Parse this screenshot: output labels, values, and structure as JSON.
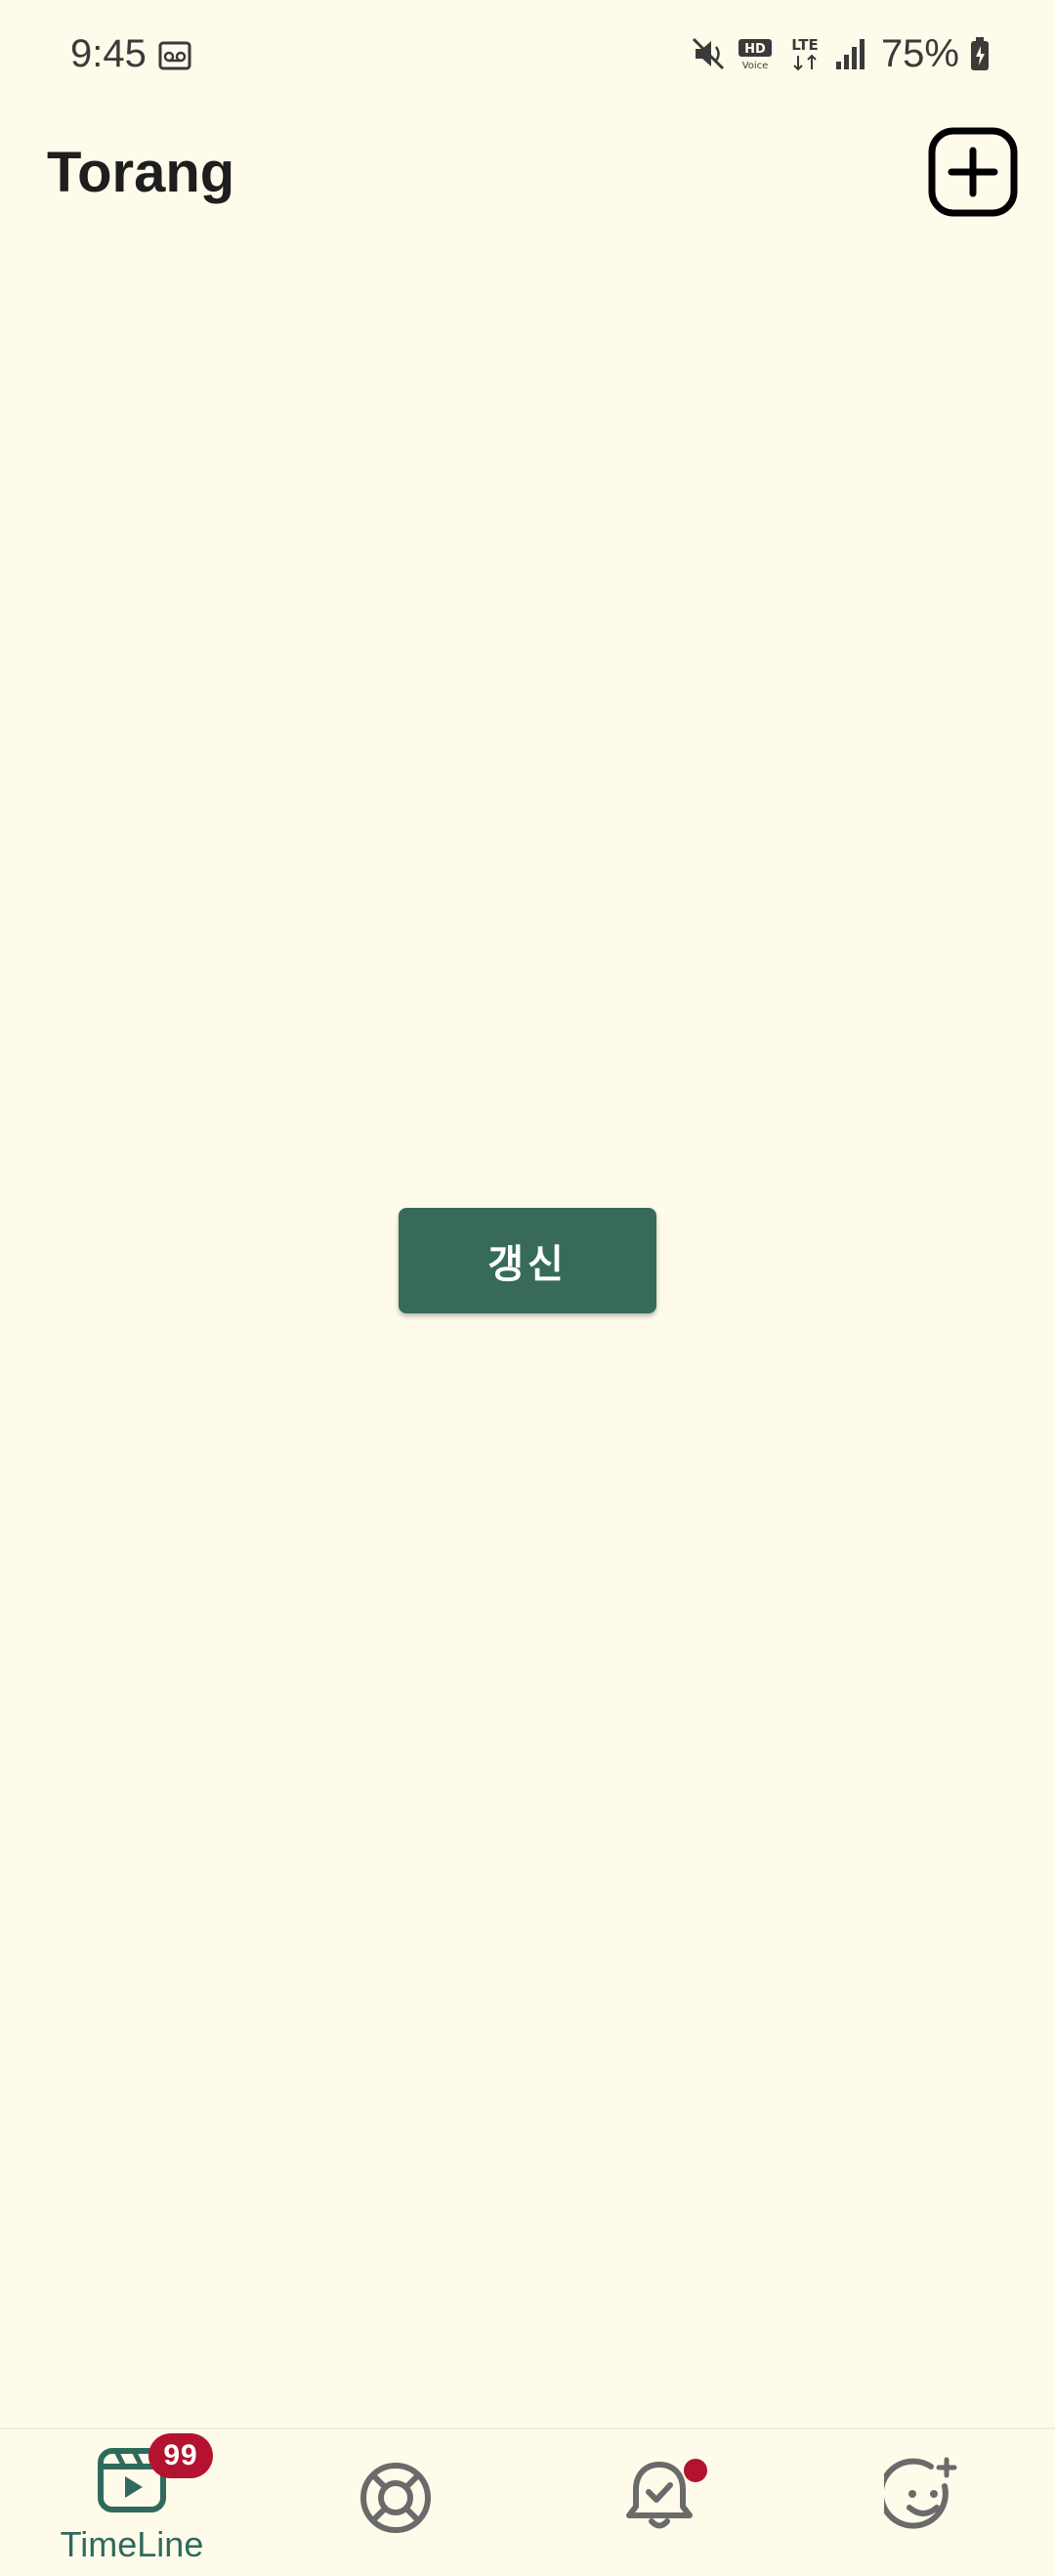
{
  "status_bar": {
    "time": "9:45",
    "battery": "75%",
    "icons": [
      "voicemail-icon",
      "mute-icon",
      "hd-voice-icon",
      "lte-icon",
      "signal-icon",
      "battery-charging-icon"
    ]
  },
  "app_bar": {
    "title": "Torang",
    "add_icon": "plus-square-icon"
  },
  "main": {
    "refresh_label": "갱신"
  },
  "bottom_nav": {
    "items": [
      {
        "label": "TimeLine",
        "icon": "play-clapper-icon",
        "badge": "99",
        "active": true
      },
      {
        "icon": "lifebuoy-icon"
      },
      {
        "icon": "bell-check-icon",
        "has_dot": true
      },
      {
        "icon": "smile-sparkle-icon"
      }
    ]
  },
  "colors": {
    "background": "#fffbea",
    "accent": "#376a5b",
    "badge": "#b3132e",
    "icon_inactive": "#6a6a6a"
  }
}
